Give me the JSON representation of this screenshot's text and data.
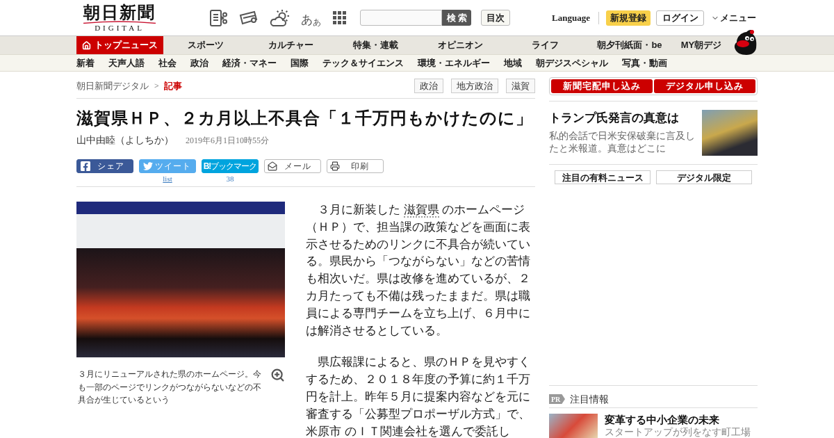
{
  "header": {
    "logo": {
      "title": "朝日新聞",
      "subtitle": "DIGITAL"
    },
    "font_size_button": {
      "large": "あ",
      "small": "あ"
    },
    "search_button": "検索",
    "index_button": "目次",
    "language_link": "Language",
    "register_button": "新規登録",
    "login_button": "ログイン",
    "menu_button": "メニュー"
  },
  "main_nav": [
    {
      "kind": "home",
      "label": "トップニュース",
      "selected": true
    },
    {
      "kind": "section",
      "label": "スポーツ",
      "selected": false
    },
    {
      "kind": "section",
      "label": "カルチャー",
      "selected": false
    },
    {
      "kind": "section",
      "label": "特集・連載",
      "selected": false
    },
    {
      "kind": "section",
      "label": "オピニオン",
      "selected": false
    },
    {
      "kind": "section",
      "label": "ライフ",
      "selected": false
    },
    {
      "kind": "section",
      "label": "朝夕刊紙面・be",
      "selected": false
    },
    {
      "kind": "section",
      "label": "MY朝デジ",
      "selected": false
    }
  ],
  "sub_nav": [
    "新着",
    "天声人語",
    "社会",
    "政治",
    "経済・マネー",
    "国際",
    "テック＆サイエンス",
    "環境・エネルギー",
    "地域",
    "朝デジスペシャル",
    "写真・動画"
  ],
  "breadcrumb": {
    "separator": ">",
    "items": [
      {
        "label": "朝日新聞デジタル",
        "current": false
      },
      {
        "label": "記事",
        "current": true
      }
    ]
  },
  "tags": [
    "政治",
    "地方政治",
    "滋賀"
  ],
  "article": {
    "title": "滋賀県ＨＰ、２カ月以上不具合「１千万円もかけたのに」",
    "author": "山中由睦（よしちか）",
    "date": "2019年6月1日10時55分",
    "share": [
      {
        "kind": "facebook",
        "label": "シェア"
      },
      {
        "kind": "twitter",
        "label": "ツイート",
        "count": "list"
      },
      {
        "kind": "hatena",
        "label": "**B!**ブックマーク",
        "count": "38"
      },
      {
        "kind": "mail",
        "label": "メール"
      },
      {
        "kind": "print",
        "label": "印刷"
      }
    ],
    "photo": {
      "caption": "３月にリニューアルされた県のホームページ。今も一部のページでリンクがつながらないなどの不具合が生じているという"
    },
    "paragraphs": [
      {
        "parts": [
          {
            "kind": "text",
            "text": "　３月に新装した "
          },
          {
            "kind": "link",
            "text": "滋賀県"
          },
          {
            "kind": "text",
            "text": " のホームページ（ＨＰ）で、担当課の政策などを画面に表示させるためのリンクに不具合が続いている。県民から「つながらない」などの苦情も相次いだ。県は改修を進めているが、２カ月たっても不備は残ったままだ。県は職員による専門チームを立ち上げ、６月中には解消させるとしている。"
          }
        ]
      },
      {
        "parts": [
          {
            "kind": "text",
            "text": "　県広報課によると、県のＨＰを見やすくするため、２０１８年度の予算に約１千万円を計上。昨年５月に提案内容などを元に審査する「公募型プロポーザル方式」で、 "
          },
          {
            "kind": "link",
            "text": "米原市"
          },
          {
            "kind": "text",
            "text": " のＩＴ関連会社を選んで委託し"
          }
        ]
      }
    ]
  },
  "sidebar": {
    "subscribe_buttons": [
      "新聞宅配申し込み",
      "デジタル申し込み"
    ],
    "feature": {
      "headline": "トランプ氏発言の真意は",
      "summary": "私的会話で日米安保破棄に言及したと米報道。真意はどこに"
    },
    "list_buttons": [
      "注目の有料ニュース",
      "デジタル限定"
    ],
    "promo": {
      "badge": "PR",
      "title": "注目情報",
      "items": [
        {
          "headline": "変革する中小企業の未来",
          "summary": "スタートアップが列をなす町工場"
        }
      ]
    }
  }
}
